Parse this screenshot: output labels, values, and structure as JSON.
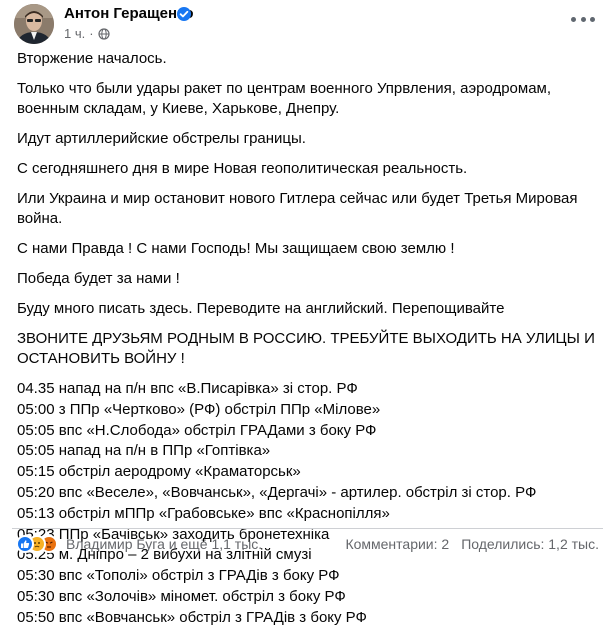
{
  "post": {
    "author_name": "Антон Геращенко",
    "time": "1 ч.",
    "dot": "·",
    "paragraphs": [
      "Вторжение началось.",
      "Только что были удары ракет по центрам военного Упрвления, аэродромам, военным складам, у Киеве, Харькове, Днепру.",
      "Идут артиллерийские обстрелы границы.",
      "С сегодняшнего дня в мире Новая геополитическая реальность.",
      "Или Украина и мир остановит нового Гитлера сейчас или будет Третья Мировая война.",
      "С нами Правда ! С нами Господь! Мы защищаем свою землю !",
      "Победа будет за нами !",
      "Буду много писать здесь. Переводите на английский. Перепощивайте",
      "ЗВОНИТЕ ДРУЗЬЯМ РОДНЫМ В РОССИЮ. ТРЕБУЙТЕ ВЫХОДИТЬ НА УЛИЦЫ И ОСТАНОВИТЬ ВОЙНУ !"
    ],
    "timeline": [
      "04.35 напад на п/н впс «В.Писарівка» зі стор. РФ",
      "05:00 з ППр «Чертково» (РФ) обстріл ППр «Мілове»",
      "05:05 впс «Н.Слобода» обстріл ГРАДами з боку РФ",
      "05:05 напад на п/н в ППр «Гоптівка»",
      "05:15 обстріл аеродрому «Краматорськ»",
      "05:20 впс «Веселе», «Вовчанськ», «Дергачі» - артилер. обстріл зі стор. РФ",
      "05:13 обстріл мППр «Грабовське» впс «Краснопілля»",
      "05:23 ППр «Бачівськ» заходить бронетехніка",
      "05:25 м. Дніпро – 2 вибухи на злітній смузі",
      "05:30 впс «Тополі» обстріл з ГРАДів з боку РФ",
      "05:30 впс «Золочів» міномет. обстріл з боку РФ",
      "05:50 впс «Вовчанськ» обстріл з ГРАДів з боку РФ"
    ]
  },
  "footer": {
    "reactions_text": "Владимир Буга и ещё 1,1 тыс.",
    "comments": "Комментарии: 2",
    "shares": "Поделились: 1,2 тыс."
  },
  "icons": {
    "avatar": "avatar",
    "verified": "verified-badge-icon",
    "privacy": "globe-icon",
    "more": "more-options-icon",
    "reactions": [
      "like-icon",
      "sad-icon",
      "angry-icon"
    ]
  },
  "colors": {
    "accent": "#1877f2",
    "secondary_text": "#65676b",
    "text": "#050505"
  }
}
